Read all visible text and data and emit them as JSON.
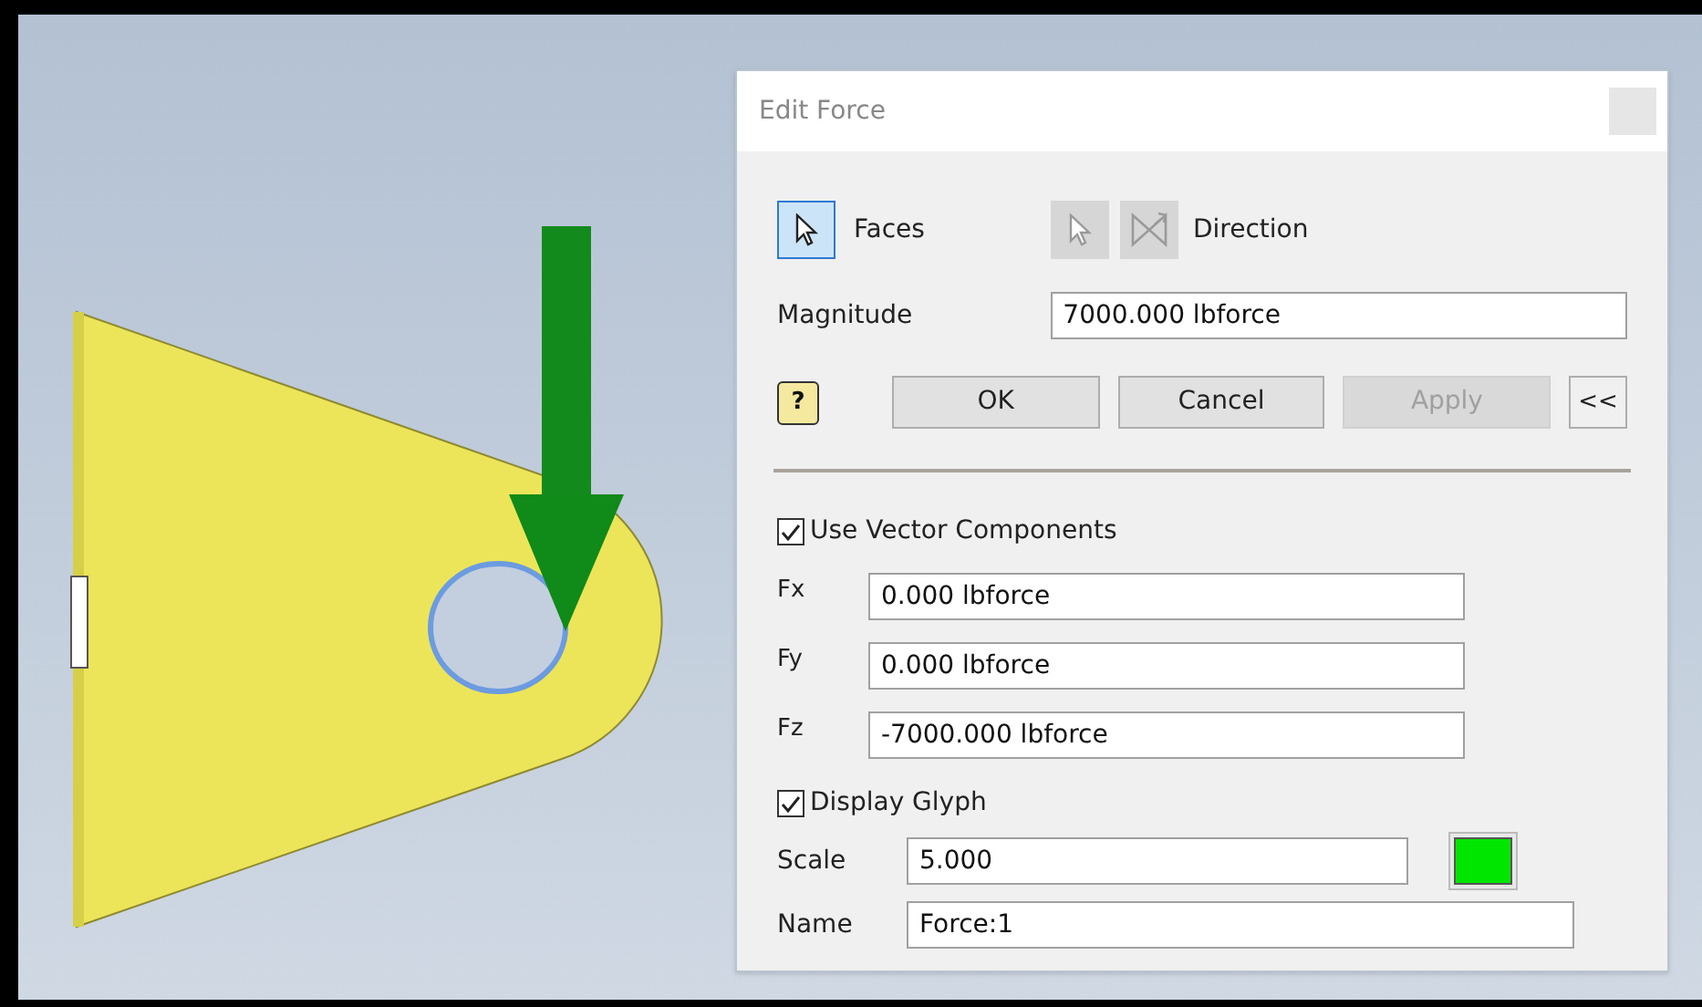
{
  "dialog": {
    "title": "Edit Force",
    "selectors": [
      {
        "kind": "labeled",
        "label": "Faces",
        "selected": true
      },
      {
        "kind": "direction",
        "label": "Direction",
        "disabled": true
      }
    ],
    "magnitude": {
      "label": "Magnitude",
      "value": "7000.000 lbforce"
    },
    "buttons": [
      {
        "kind": "help",
        "label": "?",
        "disabled": false
      },
      {
        "kind": "action",
        "label": "OK",
        "disabled": false
      },
      {
        "kind": "action",
        "label": "Cancel",
        "disabled": false
      },
      {
        "kind": "action",
        "label": "Apply",
        "disabled": true
      },
      {
        "kind": "toggle",
        "label": "<<",
        "disabled": false
      }
    ],
    "vector_components": {
      "label": "Use Vector Components",
      "checked": true
    },
    "components": [
      {
        "label": "Fx",
        "value": "0.000 lbforce"
      },
      {
        "label": "Fy",
        "value": "0.000 lbforce"
      },
      {
        "label": "Fz",
        "value": "-7000.000 lbforce"
      }
    ],
    "display_glyph": {
      "label": "Display Glyph",
      "checked": true
    },
    "scale": {
      "label": "Scale",
      "value": "5.000",
      "color": "#00e600"
    },
    "name": {
      "label": "Name",
      "value": "Force:1"
    }
  }
}
